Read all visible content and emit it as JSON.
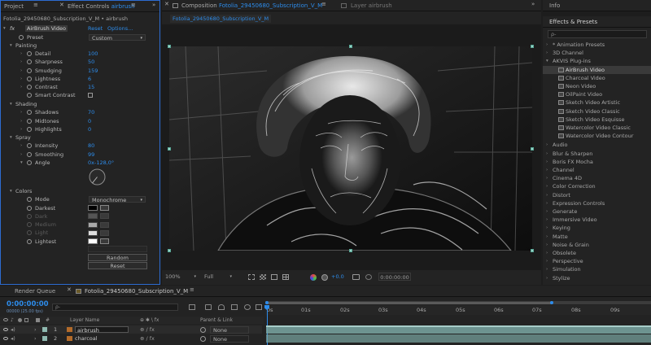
{
  "colors": {
    "accent": "#2d8ceb",
    "panel": "#232323",
    "bg": "#1d1d1d",
    "selected": "#3a3a3a",
    "track": "#7aa7a3"
  },
  "left_panel": {
    "tabs": [
      {
        "label": "Project"
      },
      {
        "label": "Effect Controls",
        "target": "airbrush"
      }
    ],
    "breadcrumb": "Fotolia_29450680_Subscription_V_M • airbrush",
    "effect": {
      "prefix": "fx",
      "name": "AirBrush Video",
      "reset": "Reset",
      "options": "Options..."
    },
    "preset": {
      "label": "Preset",
      "value": "Custom"
    },
    "groups": {
      "painting": "Painting",
      "shading": "Shading",
      "spray": "Spray",
      "colors": "Colors"
    },
    "painting": [
      {
        "label": "Detail",
        "value": "100"
      },
      {
        "label": "Sharpness",
        "value": "50"
      },
      {
        "label": "Smudging",
        "value": "159"
      },
      {
        "label": "Lightness",
        "value": "6"
      },
      {
        "label": "Contrast",
        "value": "15"
      },
      {
        "label": "Smart Contrast",
        "value": ""
      }
    ],
    "shading": [
      {
        "label": "Shadows",
        "value": "70"
      },
      {
        "label": "Midtones",
        "value": "0"
      },
      {
        "label": "Highlights",
        "value": "0"
      }
    ],
    "spray": [
      {
        "label": "Intensity",
        "value": "80"
      },
      {
        "label": "Smoothing",
        "value": "99"
      },
      {
        "label": "Angle",
        "value": "0x-128,0°"
      }
    ],
    "colors": {
      "mode_label": "Mode",
      "mode_value": "Monochrome",
      "items": [
        {
          "label": "Darkest",
          "color": "#000000"
        },
        {
          "label": "Dark",
          "color": "#555555"
        },
        {
          "label": "Medium",
          "color": "#aaaaaa"
        },
        {
          "label": "Light",
          "color": "#dddddd"
        },
        {
          "label": "Lightest",
          "color": "#ffffff"
        }
      ]
    },
    "buttons": {
      "random": "Random",
      "reset": "Reset"
    }
  },
  "composition": {
    "tab_prefix": "Composition",
    "tab_name": "Fotolia_29450680_Subscription_V_M",
    "layer_tab": "Layer airbrush",
    "sub_tab": "Fotolia_29450680_Subscription_V_M",
    "zoom": "100%",
    "resolution": "Full",
    "exposure": "+0.0",
    "timecode": "0:00:00:00"
  },
  "right_panel": {
    "info_tab": "Info",
    "effects_tab": "Effects & Presets",
    "search_placeholder": "ρ-",
    "categories": [
      "* Animation Presets",
      "3D Channel",
      "AKVIS Plug-ins",
      "Audio",
      "Blur & Sharpen",
      "Boris FX Mocha",
      "Channel",
      "Cinema 4D",
      "Color Correction",
      "Distort",
      "Expression Controls",
      "Generate",
      "Immersive Video",
      "Keying",
      "Matte",
      "Noise & Grain",
      "Obsolete",
      "Perspective",
      "Simulation",
      "Stylize"
    ],
    "akvis_items": [
      "AirBrush Video",
      "Charcoal Video",
      "Neon Video",
      "OilPaint Video",
      "Sketch Video Artistic",
      "Sketch Video Classic",
      "Sketch Video Esquisse",
      "Watercolor Video Classic",
      "Watercolor Video Contour"
    ]
  },
  "timeline": {
    "tabs": [
      "Render Queue",
      "Fotolia_29450680_Subscription_V_M"
    ],
    "timecode": "0:00:00:00",
    "fps": "00000 (25.00 fps)",
    "search_placeholder": "ρ-",
    "columns": {
      "layer_name": "Layer Name",
      "parent": "Parent & Link"
    },
    "ticks": [
      "0s",
      "01s",
      "02s",
      "03s",
      "04s",
      "05s",
      "06s",
      "07s",
      "08s",
      "09s"
    ],
    "layers": [
      {
        "num": "1",
        "name": "airbrush",
        "parent": "None"
      },
      {
        "num": "2",
        "name": "charcoal",
        "parent": "None"
      }
    ]
  }
}
